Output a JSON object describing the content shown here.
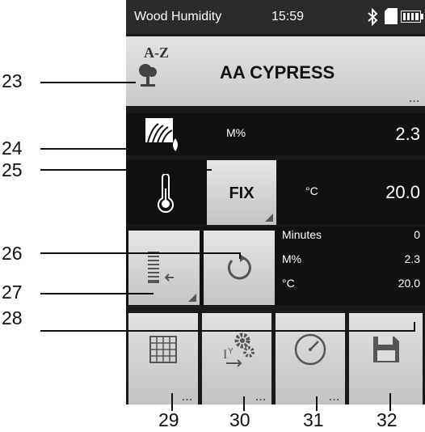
{
  "status_bar": {
    "title": "Wood Humidity",
    "time": "15:59",
    "bluetooth_icon": "bluetooth-icon",
    "sd_icon": "sd-card-icon",
    "battery_icon": "battery-icon"
  },
  "species": {
    "az_label": "A-Z",
    "name": "AA CYPRESS",
    "more": "..."
  },
  "moisture": {
    "unit": "M%",
    "value": "2.3"
  },
  "temperature": {
    "fix_label": "FIX",
    "unit": "°C",
    "value": "20.0"
  },
  "log": {
    "rows": [
      {
        "label": "Minutes",
        "value": "0"
      },
      {
        "label": "M%",
        "value": "2.3"
      },
      {
        "label": "°C",
        "value": "20.0"
      }
    ]
  },
  "bottom_buttons": {
    "grid_more": "...",
    "settings_more": "...",
    "timer_more": "..."
  },
  "callouts": [
    "23",
    "24",
    "25",
    "26",
    "27",
    "28",
    "29",
    "30",
    "31",
    "32"
  ]
}
